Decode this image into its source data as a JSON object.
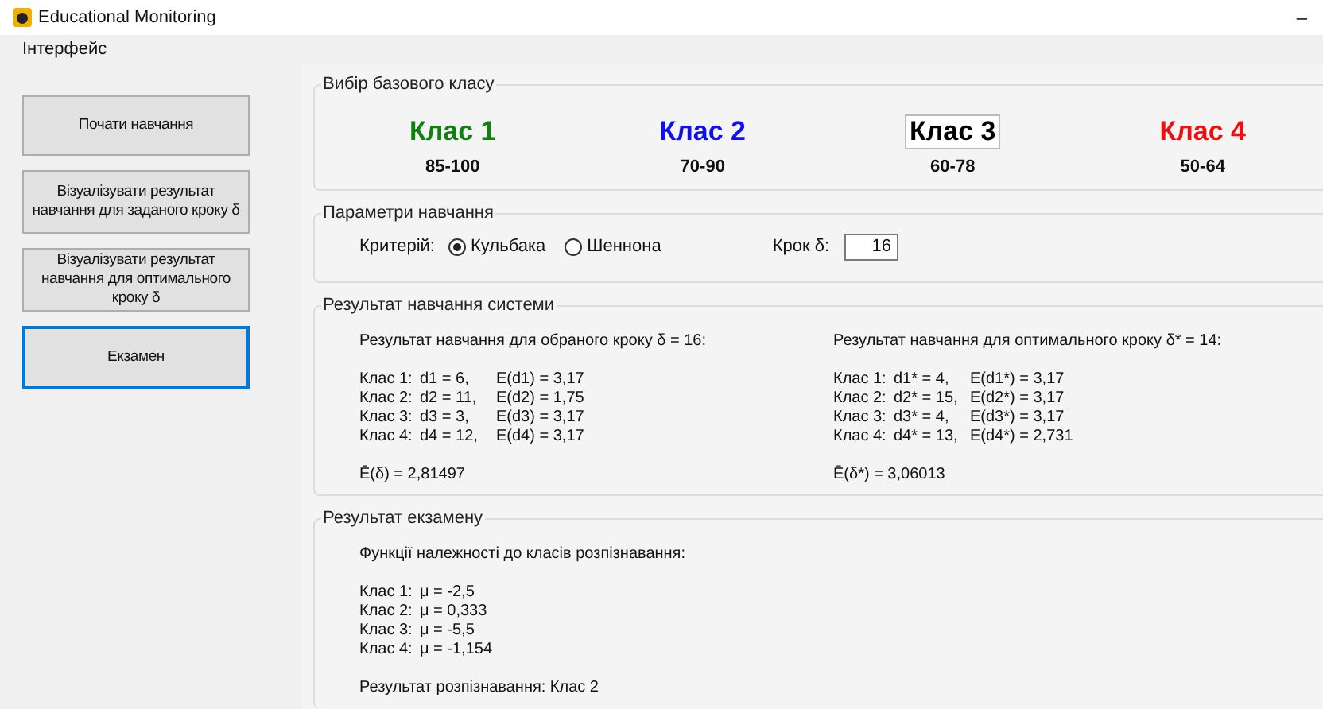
{
  "window": {
    "title": "Educational Monitoring",
    "minimize": "–"
  },
  "menu": [
    "Інтерфейс"
  ],
  "buttons": [
    {
      "label": "Почати навчання",
      "focused": false
    },
    {
      "label": "Візуалізувати результат навчання для заданого кроку  δ",
      "focused": false
    },
    {
      "label": "Візуалізувати результат навчання для оптимального кроку  δ",
      "focused": false
    },
    {
      "label": "Екзамен",
      "focused": true
    }
  ],
  "base_class": {
    "title": "Вибір базового класу",
    "classes": [
      {
        "label": "Клас 1",
        "range": "85-100",
        "color": "#108010",
        "selected": false
      },
      {
        "label": "Клас 2",
        "range": "70-90",
        "color": "#1010ee",
        "selected": false
      },
      {
        "label": "Клас 3",
        "range": "60-78",
        "color": "#000000",
        "selected": true
      },
      {
        "label": "Клас 4",
        "range": "50-64",
        "color": "#ee1010",
        "selected": false
      }
    ]
  },
  "params": {
    "title": "Параметри навчання",
    "criterion_label": "Критерій:",
    "options": [
      {
        "label": "Кульбака",
        "selected": true
      },
      {
        "label": "Шеннона",
        "selected": false
      }
    ],
    "step_label": "Крок δ:",
    "step_value": "16"
  },
  "training_result": {
    "title": "Результат навчання системи",
    "panels": [
      {
        "heading": "Результат навчання для обраного кроку δ  = 16:",
        "rows": [
          [
            "Клас 1:",
            "d1 = 6,",
            "E(d1) = 3,17"
          ],
          [
            "Клас 2:",
            "d2 = 11,",
            "E(d2) = 1,75"
          ],
          [
            "Клас 3:",
            "d3 = 3,",
            "E(d3) = 3,17"
          ],
          [
            "Клас 4:",
            "d4 = 12,",
            "E(d4) = 3,17"
          ]
        ],
        "total": "Ē(δ) = 2,81497"
      },
      {
        "heading": "Результат навчання для оптимального кроку δ* = 14:",
        "rows": [
          [
            "Клас 1:",
            "d1* = 4,",
            "E(d1*) = 3,17"
          ],
          [
            "Клас 2:",
            "d2* = 15,",
            "E(d2*) = 3,17"
          ],
          [
            "Клас 3:",
            "d3* = 4,",
            "E(d3*) = 3,17"
          ],
          [
            "Клас 4:",
            "d4* = 13,",
            "E(d4*) = 2,731"
          ]
        ],
        "total": "Ē(δ*) = 3,06013"
      }
    ]
  },
  "exam": {
    "title": "Результат екзамену",
    "heading": "Функції належності до класів розпізнавання:",
    "rows": [
      [
        "Клас 1:",
        "μ = -2,5"
      ],
      [
        "Клас 2:",
        "μ = 0,333"
      ],
      [
        "Клас 3:",
        "μ = -5,5"
      ],
      [
        "Клас 4:",
        "μ = -1,154"
      ]
    ],
    "result": "Результат розпізнавання: Клас 2"
  }
}
